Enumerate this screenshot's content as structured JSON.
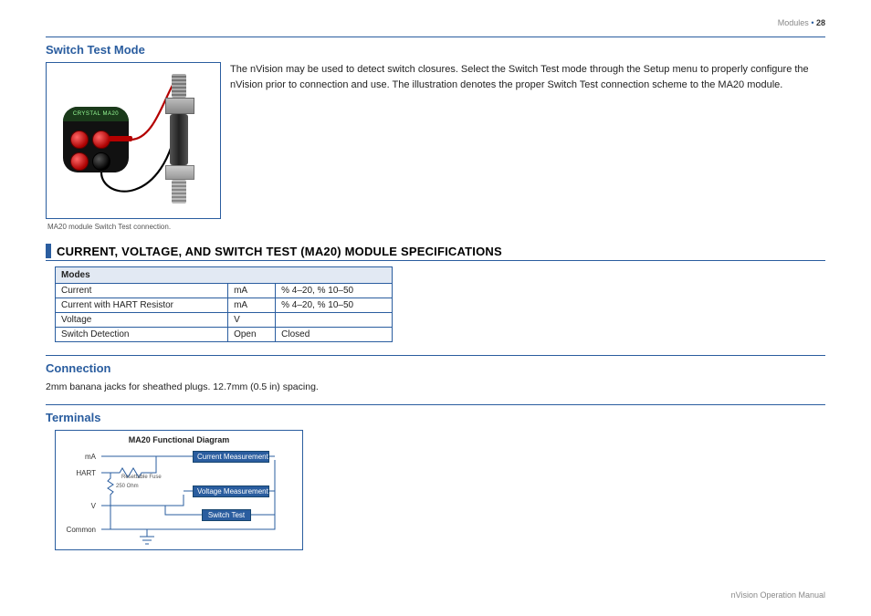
{
  "header": {
    "section": "Modules",
    "page": "28"
  },
  "switch_test": {
    "title": "Switch Test Mode",
    "text": "The nVision may be used to detect switch closures. Select the Switch Test mode through the Setup menu to properly configure the nVision prior to connection and use. The illustration  denotes the proper Switch Test connection scheme to the MA20 module.",
    "caption": "MA20 module Switch Test connection.",
    "device_label": "CRYSTAL MA20"
  },
  "spec": {
    "heading": "CURRENT, VOLTAGE, AND SWITCH TEST (MA20) MODULE SPECIFICATIONS",
    "table": {
      "header": "Modes",
      "rows": [
        {
          "c1": "Current",
          "c2": "mA",
          "c3": "% 4–20,  % 10–50"
        },
        {
          "c1": "Current with HART Resistor",
          "c2": "mA",
          "c3": "% 4–20,  % 10–50"
        },
        {
          "c1": "Voltage",
          "c2": "V",
          "c3": ""
        },
        {
          "c1": "Switch Detection",
          "c2": "Open",
          "c3": "Closed"
        }
      ]
    }
  },
  "connection": {
    "title": "Connection",
    "text": "2mm banana jacks for sheathed plugs. 12.7mm (0.5 in) spacing."
  },
  "terminals": {
    "title": "Terminals",
    "diagram_title": "MA20 Functional Diagram",
    "labels": {
      "ma": "mA",
      "hart": "HART",
      "v": "V",
      "common": "Common"
    },
    "boxes": {
      "current": "Current Measurement",
      "voltage": "Voltage Measurement",
      "switch": "Switch Test"
    },
    "fuse": "Resettable Fuse",
    "ohm": "250 Ohm"
  },
  "footer": "nVision Operation Manual"
}
